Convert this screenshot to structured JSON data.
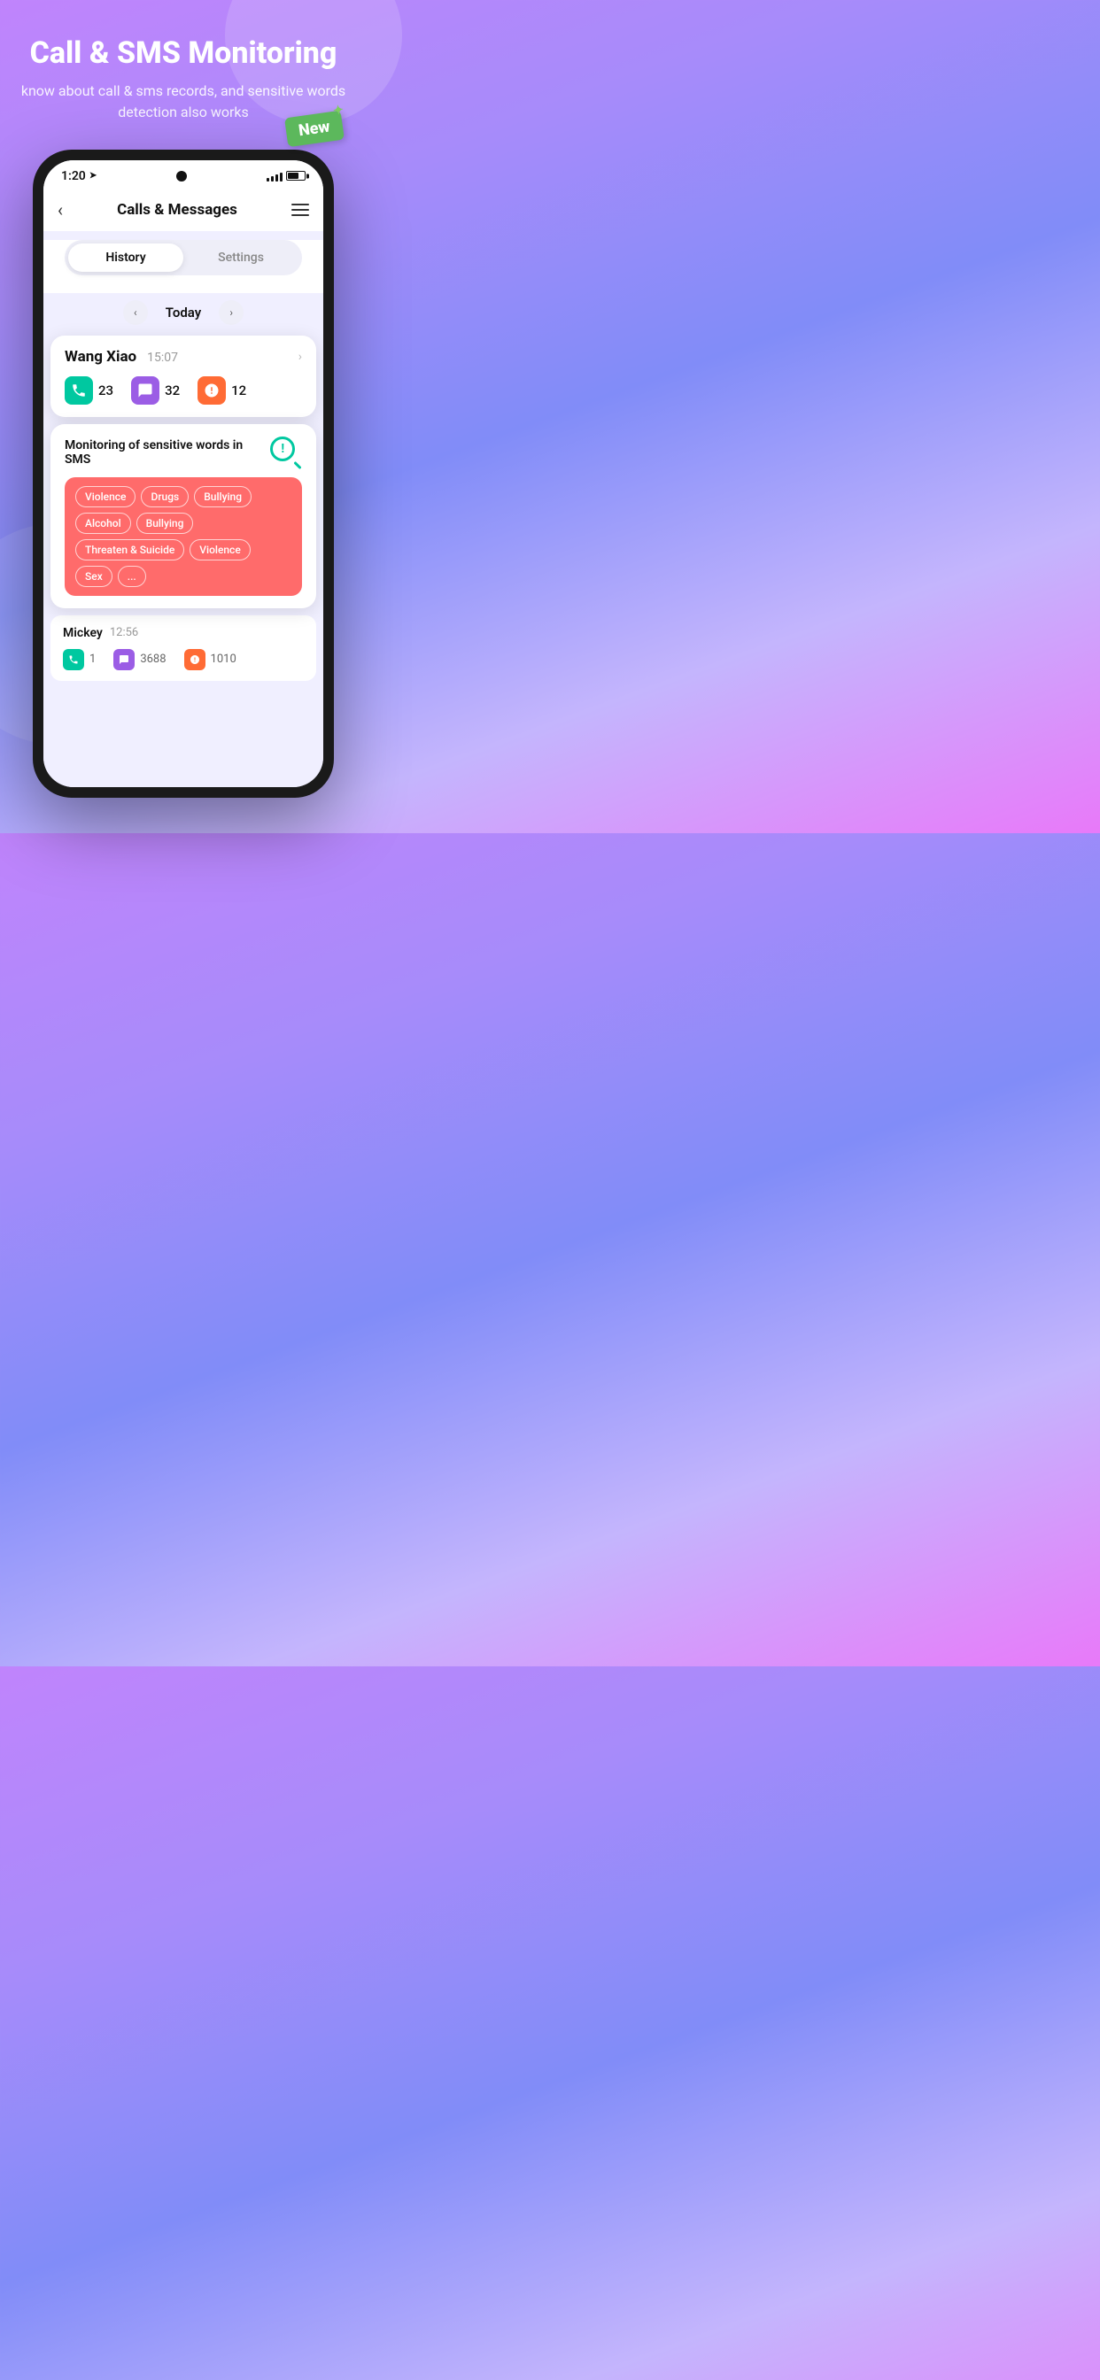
{
  "hero": {
    "title": "Call & SMS Monitoring",
    "subtitle": "know about call & sms records, and sensitive words detection also works"
  },
  "new_badge": "New",
  "status_bar": {
    "time": "1:20",
    "arrow": "➤"
  },
  "app_header": {
    "back": "‹",
    "title": "Calls & Messages"
  },
  "tabs": {
    "history": "History",
    "settings": "Settings"
  },
  "date_nav": {
    "prev": "‹",
    "label": "Today",
    "next": "›"
  },
  "contact_card": {
    "name": "Wang Xiao",
    "time": "15:07",
    "calls": "23",
    "messages": "32",
    "alerts": "12"
  },
  "sensitive_card": {
    "title": "Monitoring of sensitive words in SMS",
    "tags": [
      "Violence",
      "Drugs",
      "Bullying",
      "Alcohol",
      "Bullying",
      "Threaten & Suicide",
      "Violence",
      "Sex",
      "..."
    ]
  },
  "contact_card_2": {
    "name": "Mickey",
    "time": "12:56",
    "calls": "1",
    "messages": "3688",
    "alerts": "1010"
  }
}
